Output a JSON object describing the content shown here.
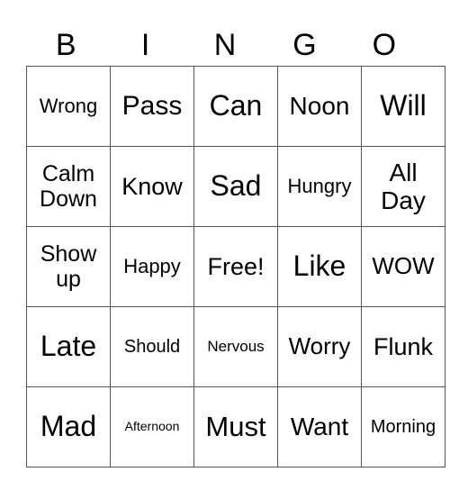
{
  "header": [
    "B",
    "I",
    "N",
    "G",
    "O"
  ],
  "cells": [
    [
      {
        "text": "Wrong",
        "size": 22
      },
      {
        "text": "Pass",
        "size": 30
      },
      {
        "text": "Can",
        "size": 32
      },
      {
        "text": "Noon",
        "size": 28
      },
      {
        "text": "Will",
        "size": 32
      }
    ],
    [
      {
        "text": "Calm Down",
        "size": 25
      },
      {
        "text": "Know",
        "size": 27
      },
      {
        "text": "Sad",
        "size": 32
      },
      {
        "text": "Hungry",
        "size": 22
      },
      {
        "text": "All Day",
        "size": 28
      }
    ],
    [
      {
        "text": "Show up",
        "size": 25
      },
      {
        "text": "Happy",
        "size": 22
      },
      {
        "text": "Free!",
        "size": 27
      },
      {
        "text": "Like",
        "size": 32
      },
      {
        "text": "WOW",
        "size": 26
      }
    ],
    [
      {
        "text": "Late",
        "size": 32
      },
      {
        "text": "Should",
        "size": 20
      },
      {
        "text": "Nervous",
        "size": 17
      },
      {
        "text": "Worry",
        "size": 26
      },
      {
        "text": "Flunk",
        "size": 27
      }
    ],
    [
      {
        "text": "Mad",
        "size": 32
      },
      {
        "text": "Afternoon",
        "size": 14
      },
      {
        "text": "Must",
        "size": 31
      },
      {
        "text": "Want",
        "size": 28
      },
      {
        "text": "Morning",
        "size": 20
      }
    ]
  ]
}
